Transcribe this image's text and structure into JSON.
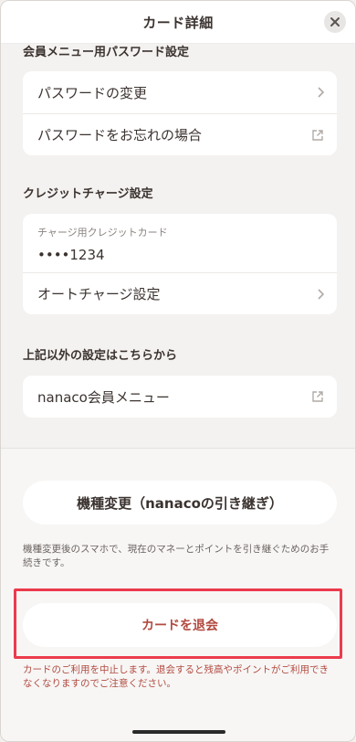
{
  "header": {
    "title": "カード詳細"
  },
  "password_section": {
    "heading": "会員メニュー用パスワード設定",
    "items": [
      {
        "label": "パスワードの変更",
        "icon": "chevron-right-icon"
      },
      {
        "label": "パスワードをお忘れの場合",
        "icon": "external-link-icon"
      }
    ]
  },
  "credit_section": {
    "heading": "クレジットチャージ設定",
    "card_caption": "チャージ用クレジットカード",
    "card_number": "••••1234",
    "auto_charge_label": "オートチャージ設定"
  },
  "other_section": {
    "heading": "上記以外の設定はこちらから",
    "link_label": "nanaco会員メニュー"
  },
  "device_change": {
    "button_label": "機種変更（nanacoの引き継ぎ）",
    "note": "機種変更後のスマホで、現在のマネーとポイントを引き継ぐためのお手続きです。"
  },
  "withdraw": {
    "button_label": "カードを退会",
    "note": "カードのご利用を中止します。退会すると残高やポイントがご利用できなくなりますのでご注意ください。"
  },
  "colors": {
    "accent": "#b24a40",
    "highlight_border": "#ec3a4d",
    "background": "#f4f2f0"
  }
}
